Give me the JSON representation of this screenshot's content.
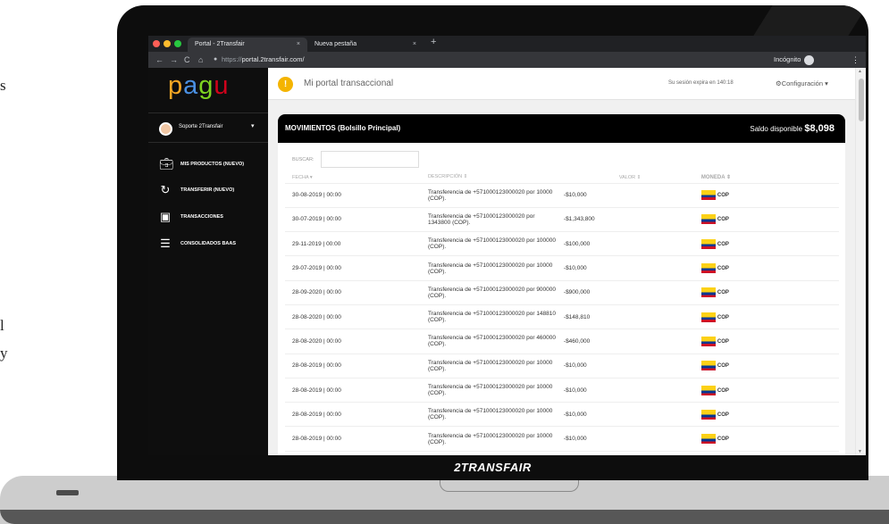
{
  "browser": {
    "tabs": [
      {
        "label": "Portal - 2Transfair",
        "close": "×"
      },
      {
        "label": "Nueva pestaña",
        "close": "×"
      }
    ],
    "new_tab": "+",
    "url_prefix": "https://",
    "url_host": "portal.2transfair.com/",
    "incognito": "Incógnito",
    "menu": "⋮",
    "nav": {
      "back": "←",
      "forward": "→",
      "reload": "C",
      "home": "⌂",
      "lock": "●"
    }
  },
  "brand": {
    "logo": "pagu",
    "footer": "2TRANSFAIR",
    "logo_colors": [
      "#f5a623",
      "#4a90e2",
      "#7ed321",
      "#d0021b"
    ]
  },
  "sidebar": {
    "user": "Soporte 2Transfair",
    "user_caret": "▾",
    "items": [
      {
        "label": "MIS PRODUCTOS (NUEVO)",
        "icon": "briefcase-icon"
      },
      {
        "label": "TRANSFERIR (NUEVO)",
        "icon": "sync-icon"
      },
      {
        "label": "TRANSACCIONES",
        "icon": "money-icon"
      },
      {
        "label": "CONSOLIDADOS BAAS",
        "icon": "table-icon"
      }
    ]
  },
  "topbar": {
    "alert": "!",
    "title": "Mi portal transaccional",
    "session": "Su sesión expira en 140:18",
    "config": "⚙Configuración ▾"
  },
  "card": {
    "title": "MOVIMIENTOS (Bolsillo Principal)",
    "balance_label": "Saldo disponible",
    "balance_value": "$8,098",
    "search_label": "BUSCAR:",
    "search_value": ""
  },
  "table": {
    "headers": [
      "FECHA ▾",
      "DESCRIPCIÓN ⇕",
      "VALOR ⇕",
      "MONEDA ⇕"
    ],
    "rows": [
      {
        "date": "30-08-2019 | 00:00",
        "desc": "Transferencia de +571000123000020 por 10000 (COP).",
        "value": "-$10,000",
        "currency": "COP"
      },
      {
        "date": "30-07-2019 | 00:00",
        "desc": "Transferencia de +571000123000020 por 1343800 (COP).",
        "value": "-$1,343,800",
        "currency": "COP"
      },
      {
        "date": "29-11-2019 | 00:00",
        "desc": "Transferencia de +571000123000020 por 100000 (COP).",
        "value": "-$100,000",
        "currency": "COP"
      },
      {
        "date": "29-07-2019 | 00:00",
        "desc": "Transferencia de +571000123000020 por 10000 (COP).",
        "value": "-$10,000",
        "currency": "COP"
      },
      {
        "date": "28-09-2020 | 00:00",
        "desc": "Transferencia de +571000123000020 por 900000 (COP).",
        "value": "-$900,000",
        "currency": "COP"
      },
      {
        "date": "28-08-2020 | 00:00",
        "desc": "Transferencia de +571000123000020 por 148810 (COP).",
        "value": "-$148,810",
        "currency": "COP"
      },
      {
        "date": "28-08-2020 | 00:00",
        "desc": "Transferencia de +571000123000020 por 460000 (COP).",
        "value": "-$460,000",
        "currency": "COP"
      },
      {
        "date": "28-08-2019 | 00:00",
        "desc": "Transferencia de +571000123000020 por 10000 (COP).",
        "value": "-$10,000",
        "currency": "COP"
      },
      {
        "date": "28-08-2019 | 00:00",
        "desc": "Transferencia de +571000123000020 por 10000 (COP).",
        "value": "-$10,000",
        "currency": "COP"
      },
      {
        "date": "28-08-2019 | 00:00",
        "desc": "Transferencia de +571000123000020 por 10000 (COP).",
        "value": "-$10,000",
        "currency": "COP"
      },
      {
        "date": "28-08-2019 | 00:00",
        "desc": "Transferencia de +571000123000020 por 10000 (COP).",
        "value": "-$10,000",
        "currency": "COP"
      }
    ]
  },
  "edge_text": [
    "s",
    "l",
    "y"
  ]
}
